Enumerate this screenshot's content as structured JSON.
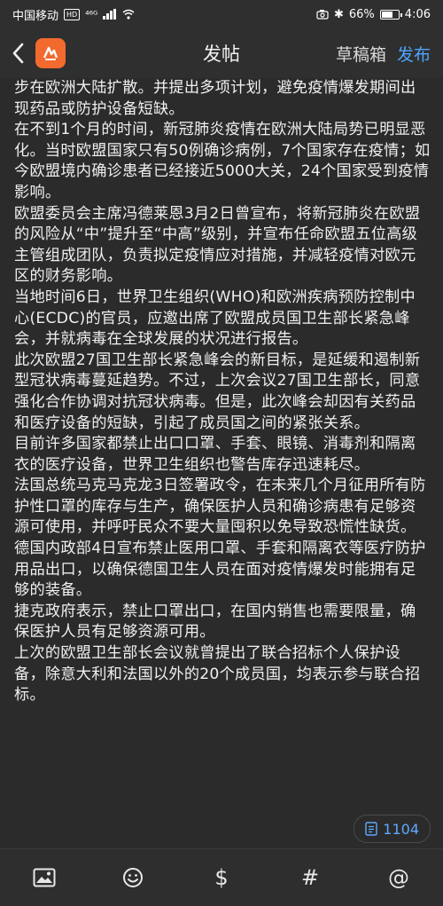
{
  "status_bar": {
    "carrier": "中国移动",
    "hd": "HD",
    "network": "⁴⁶ᴳ",
    "battery_text": "66%",
    "battery_level": 0.66,
    "time": "4:06"
  },
  "nav": {
    "title": "发帖",
    "drafts_label": "草稿箱",
    "publish_label": "发布",
    "logo_icon": "app-logo-icon"
  },
  "post": {
    "paragraphs": [
      "步在欧洲大陆扩散。并提出多项计划，避免疫情爆发期间出现药品或防护设备短缺。",
      "在不到1个月的时间，新冠肺炎疫情在欧洲大陆局势已明显恶化。当时欧盟国家只有50例确诊病例，7个国家存在疫情；如今欧盟境内确诊患者已经接近5000大关，24个国家受到疫情影响。",
      "欧盟委员会主席冯德莱恩3月2日曾宣布，将新冠肺炎在欧盟的风险从“中”提升至“中高”级别，并宣布任命欧盟五位高级主管组成团队，负责拟定疫情应对措施，并减轻疫情对欧元区的财务影响。",
      "当地时间6日，世界卫生组织(WHO)和欧洲疾病预防控制中心(ECDC)的官员，应邀出席了欧盟成员国卫生部长紧急峰会，并就病毒在全球发展的状况进行报告。",
      "此次欧盟27国卫生部长紧急峰会的新目标，是延缓和遏制新型冠状病毒蔓延趋势。不过，上次会议27国卫生部长，同意强化合作协调对抗冠状病毒。但是，此次峰会却因有关药品和医疗设备的短缺，引起了成员国之间的紧张关系。",
      "目前许多国家都禁止出口口罩、手套、眼镜、消毒剂和隔离衣的医疗设备，世界卫生组织也警告库存迅速耗尽。",
      "法国总统马克马克龙3日签署政令，在未来几个月征用所有防护性口罩的库存与生产，确保医护人员和确诊病患有足够资源可使用，并呼吁民众不要大量囤积以免导致恐慌性缺货。",
      "德国内政部4日宣布禁止医用口罩、手套和隔离衣等医疗防护用品出口，以确保德国卫生人员在面对疫情爆发时能拥有足够的装备。",
      "捷克政府表示，禁止口罩出口，在国内销售也需要限量，确保医护人员有足够资源可用。",
      "上次的欧盟卫生部长会议就曾提出了联合招标个人保护设备，除意大利和法国以外的20个成员国，均表示参与联合招标。"
    ]
  },
  "word_count": {
    "icon": "document-icon",
    "value": "1104"
  },
  "toolbar": {
    "items": [
      {
        "icon": "image-icon"
      },
      {
        "icon": "emoji-icon"
      },
      {
        "icon": "dollar-icon",
        "glyph": "$"
      },
      {
        "icon": "hashtag-icon",
        "glyph": "#"
      },
      {
        "icon": "mention-icon",
        "glyph": "@"
      }
    ]
  },
  "colors": {
    "background": "#2b2b2b",
    "accent": "#4ea3ff",
    "logo": "#f26a2e"
  }
}
